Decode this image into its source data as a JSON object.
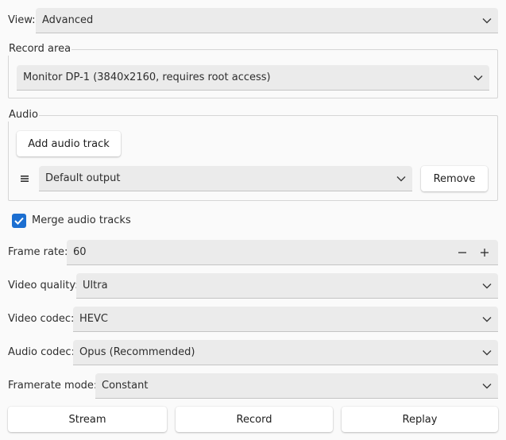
{
  "view": {
    "label": "View:",
    "value": "Advanced"
  },
  "record_area": {
    "legend": "Record area",
    "value": "Monitor DP-1 (3840x2160, requires root access)"
  },
  "audio": {
    "legend": "Audio",
    "add_track_label": "Add audio track",
    "tracks": [
      {
        "value": "Default output",
        "remove_label": "Remove"
      }
    ]
  },
  "merge_audio": {
    "label": "Merge audio tracks",
    "checked": true
  },
  "frame_rate": {
    "label": "Frame rate:",
    "value": "60",
    "decrement": "−",
    "increment": "+"
  },
  "video_quality": {
    "label": "Video quality:",
    "value": "Ultra"
  },
  "video_codec": {
    "label": "Video codec:",
    "value": "HEVC"
  },
  "audio_codec": {
    "label": "Audio codec:",
    "value": "Opus (Recommended)"
  },
  "framerate_mode": {
    "label": "Framerate mode:",
    "value": "Constant"
  },
  "actions": {
    "stream_label": "Stream",
    "record_label": "Record",
    "replay_label": "Replay"
  },
  "colors": {
    "accent": "#1c6fd1",
    "field_bg": "#ebebeb",
    "window_bg": "#fafafa"
  },
  "icons": {
    "dropdown": "chevron-down-icon",
    "drag": "drag-handle-icon",
    "check": "checkmark-icon"
  }
}
